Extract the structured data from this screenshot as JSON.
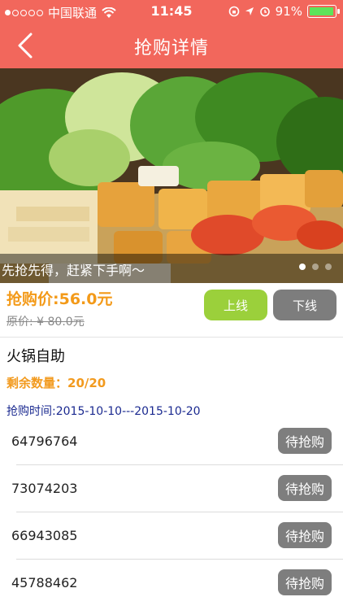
{
  "status_bar": {
    "carrier": "中国联通",
    "time": "11:45",
    "battery": "91%"
  },
  "nav": {
    "title": "抢购详情",
    "back_icon": "chevron-left-icon"
  },
  "banner": {
    "caption": "先抢先得，赶紧下手啊～",
    "page_count": 3,
    "active_page": 1
  },
  "deal": {
    "price": "抢购价:56.0元",
    "original_price": "原价: ¥ 80.0元",
    "online_label": "上线",
    "offline_label": "下线",
    "name": "火锅自助",
    "remaining": "剩余数量：20/20",
    "period": "抢购时间:2015-10-10---2015-10-20"
  },
  "codes": [
    {
      "code": "64796764",
      "status": "待抢购"
    },
    {
      "code": "73074203",
      "status": "待抢购"
    },
    {
      "code": "66943085",
      "status": "待抢购"
    },
    {
      "code": "45788462",
      "status": "待抢购"
    }
  ],
  "colors": {
    "nav_bar": "#f2675c",
    "price": "#f39a19",
    "online_button": "#9bd03b",
    "offline_button": "#7d7d7d",
    "period_text": "#1b2a90"
  }
}
